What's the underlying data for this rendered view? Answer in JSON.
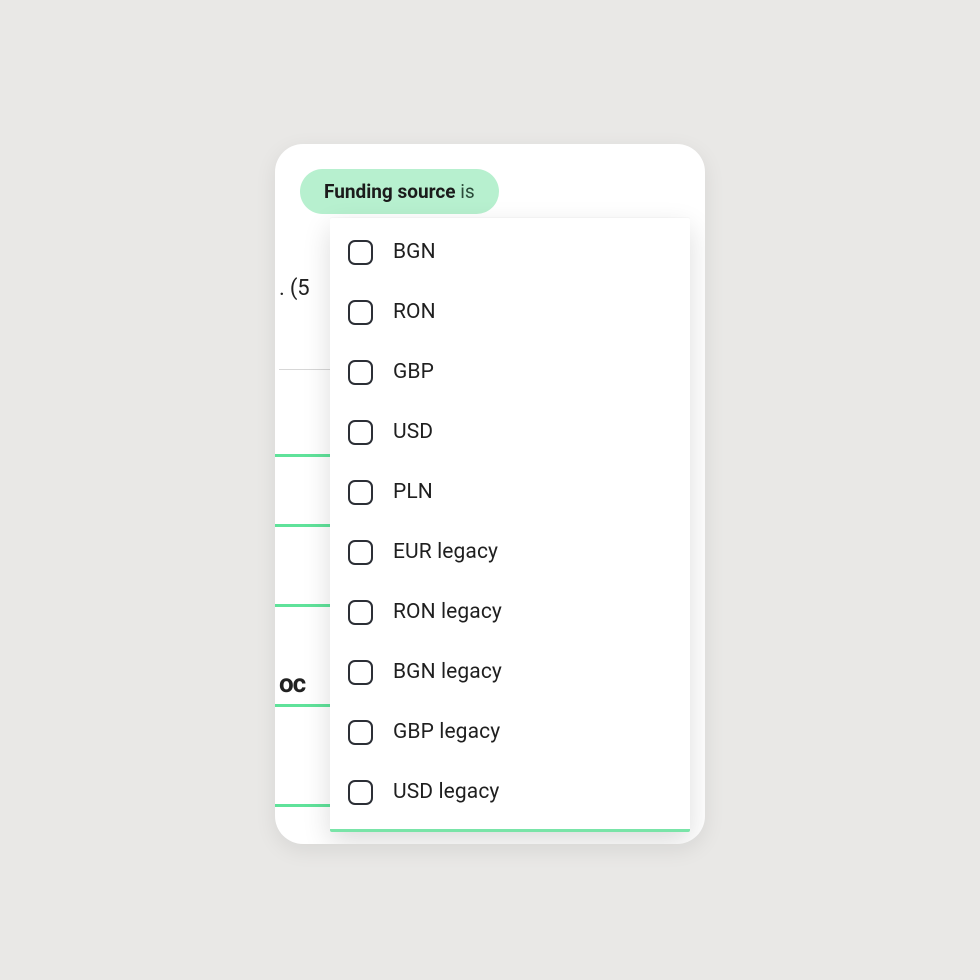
{
  "filter_chip": {
    "field": "Funding source",
    "operator": "is"
  },
  "background_fragment": ". (5",
  "background_fragment2": "oc",
  "options": [
    {
      "label": "BGN",
      "checked": false
    },
    {
      "label": "RON",
      "checked": false
    },
    {
      "label": "GBP",
      "checked": false
    },
    {
      "label": "USD",
      "checked": false
    },
    {
      "label": "PLN",
      "checked": false
    },
    {
      "label": "EUR legacy",
      "checked": false
    },
    {
      "label": "RON legacy",
      "checked": false
    },
    {
      "label": "BGN legacy",
      "checked": false
    },
    {
      "label": "GBP legacy",
      "checked": false
    },
    {
      "label": "USD legacy",
      "checked": false
    }
  ],
  "green_tick_positions": [
    310,
    380,
    460,
    560,
    660
  ]
}
